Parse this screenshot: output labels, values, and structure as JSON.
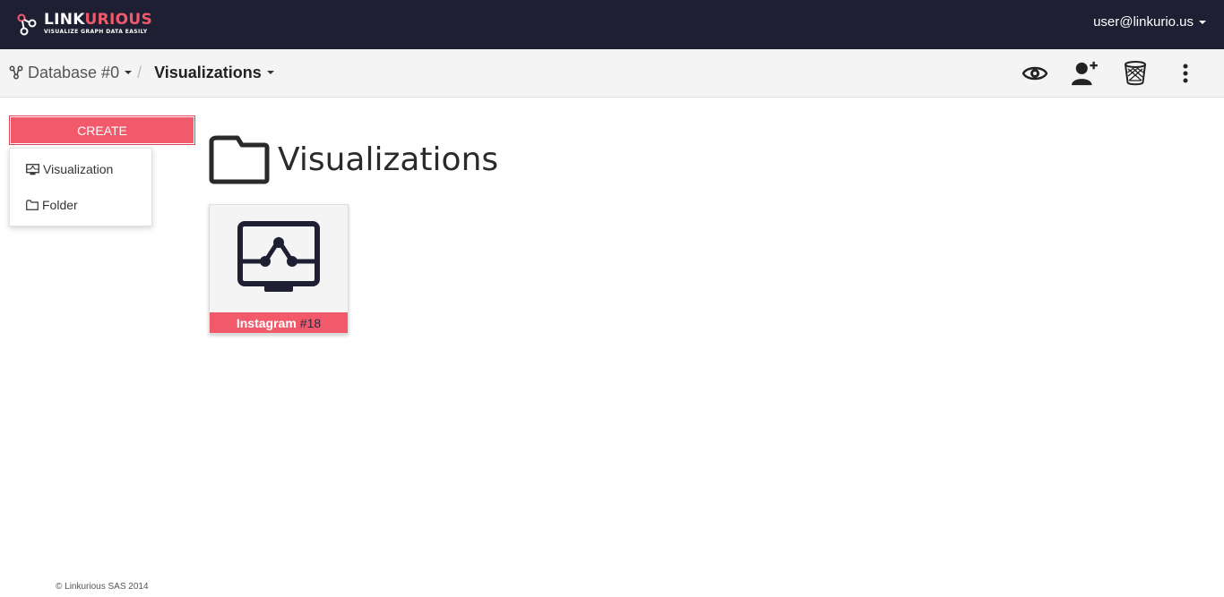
{
  "header": {
    "logo_word_main": "LINK",
    "logo_word_accent": "URIOUS",
    "logo_tagline": "VISUALIZE GRAPH DATA EASILY",
    "user_email": "user@linkurio.us"
  },
  "breadcrumb": {
    "database": "Database #0",
    "separator": "/",
    "current": "Visualizations"
  },
  "toolbar": {
    "icons": [
      "eye-icon",
      "add-user-icon",
      "trash-icon",
      "more-vertical-icon"
    ]
  },
  "sidebar": {
    "create_label": "CREATE",
    "menu": [
      {
        "label": "Visualization",
        "icon": "monitor-graph-icon"
      },
      {
        "label": "Folder",
        "icon": "folder-icon"
      }
    ]
  },
  "main": {
    "title": "Visualizations",
    "cards": [
      {
        "name": "Instagram",
        "number": "#18"
      }
    ]
  },
  "footer": {
    "copyright": "© Linkurious SAS 2014"
  },
  "colors": {
    "navbar": "#1e1f33",
    "accent": "#f25a6b",
    "subbar": "#f4f4f4"
  }
}
